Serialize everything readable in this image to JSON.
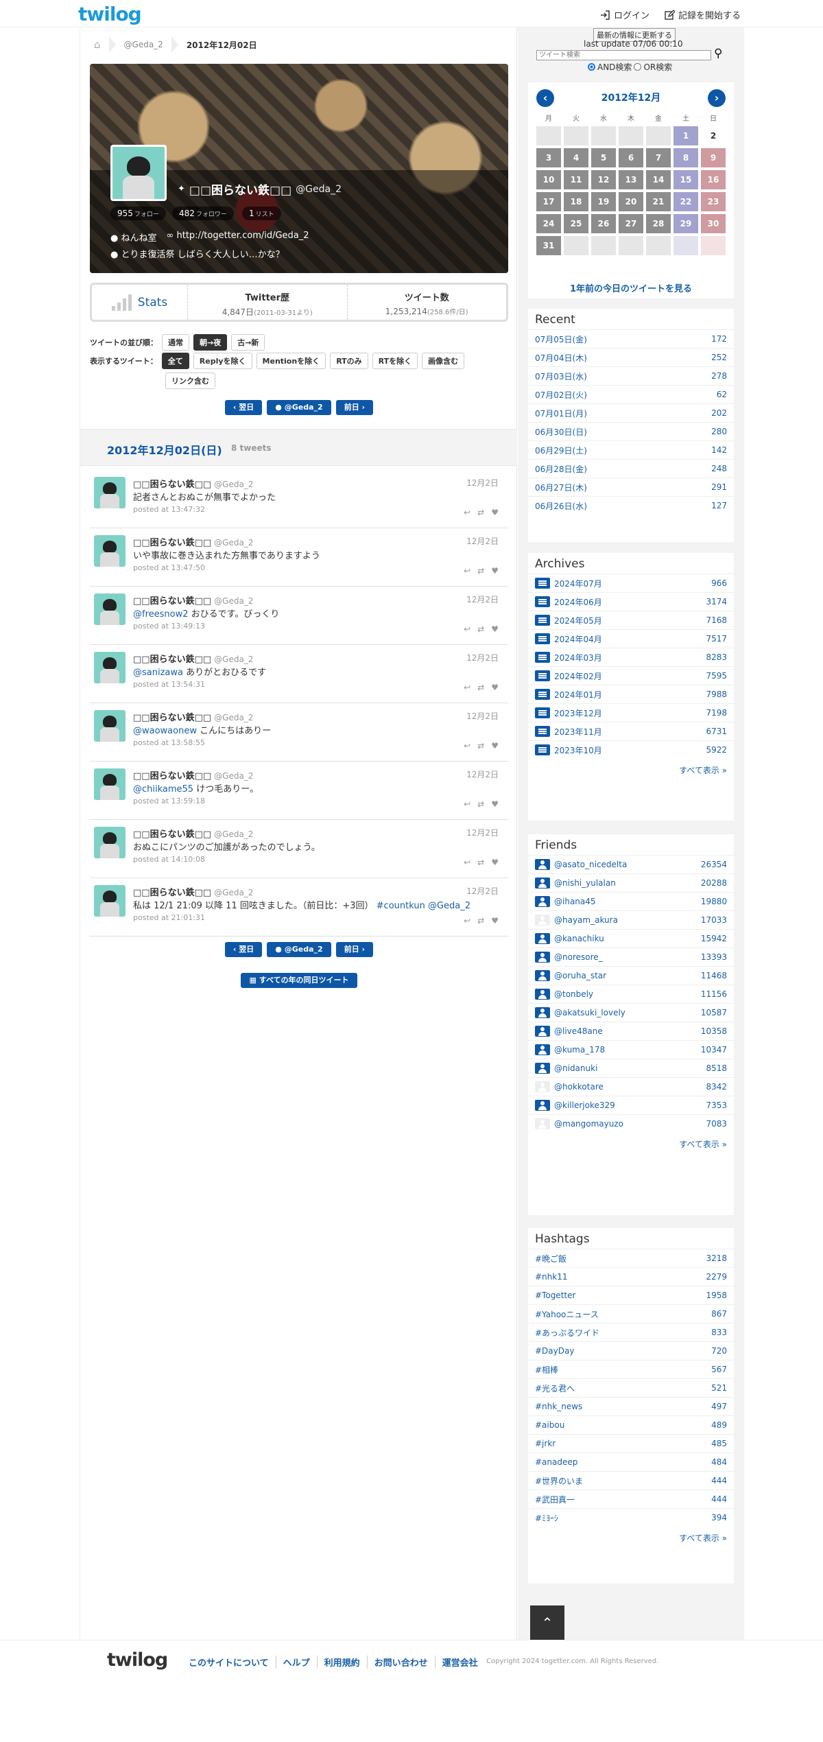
{
  "header": {
    "logo": "twilog",
    "login": "ログイン",
    "start": "記録を開始する"
  },
  "breadcrumb": {
    "user": "@Geda_2",
    "current": "2012年12月02日"
  },
  "profile": {
    "name": "□□困らない鉄□□",
    "screen_name": "@Geda_2",
    "follow_count": "955",
    "follow_label": "フォロー",
    "follower_count": "482",
    "follower_label": "フォロワー",
    "list_count": "1",
    "list_label": "リスト",
    "location": "ねんね室",
    "url": "http://togetter.com/id/Geda_2",
    "description": "とりま復活祭 しばらく大人しい…かな？"
  },
  "stats": {
    "label": "Stats",
    "history_title": "Twitter歴",
    "history_value": "4,847日",
    "history_note": "(2011-03-31より)",
    "tweets_title": "ツイート数",
    "tweets_value": "1,253,214",
    "tweets_note": "(258.6件/日)"
  },
  "filters": {
    "order_label": "ツイートの並び順：",
    "order_options": [
      "通常",
      "朝→夜",
      "古→新"
    ],
    "order_selected": "朝→夜",
    "show_label": "表示するツイート：",
    "show_options": [
      "全て",
      "Replyを除く",
      "Mentionを除く",
      "RTのみ",
      "RTを除く",
      "画像含む",
      "リンク含む"
    ],
    "show_selected": "全て"
  },
  "nav": {
    "next": "翌日",
    "user": "@Geda_2",
    "prev": "前日",
    "same_day": "すべての年の同日ツイート"
  },
  "day": {
    "date": "2012年12月02日(日)",
    "count": "8 tweets"
  },
  "tweets": [
    {
      "name": "□□困らない鉄□□",
      "screen": "@Geda_2",
      "date": "12月2日",
      "text": "記者さんとおぬこが無事でよかった",
      "time": "posted at 13:47:32"
    },
    {
      "name": "□□困らない鉄□□",
      "screen": "@Geda_2",
      "date": "12月2日",
      "text": "いや事故に巻き込まれた方無事でありますよう",
      "time": "posted at 13:47:50"
    },
    {
      "name": "□□困らない鉄□□",
      "screen": "@Geda_2",
      "date": "12月2日",
      "mention": "@freesnow2",
      "text": " おひるです。びっくり",
      "time": "posted at 13:49:13"
    },
    {
      "name": "□□困らない鉄□□",
      "screen": "@Geda_2",
      "date": "12月2日",
      "mention": "@sanizawa",
      "text": " ありがとおひるです",
      "time": "posted at 13:54:31"
    },
    {
      "name": "□□困らない鉄□□",
      "screen": "@Geda_2",
      "date": "12月2日",
      "mention": "@waowaonew",
      "text": " こんにちはありー",
      "time": "posted at 13:58:55"
    },
    {
      "name": "□□困らない鉄□□",
      "screen": "@Geda_2",
      "date": "12月2日",
      "mention": "@chiikame55",
      "text": " けつ毛ありー。",
      "time": "posted at 13:59:18"
    },
    {
      "name": "□□困らない鉄□□",
      "screen": "@Geda_2",
      "date": "12月2日",
      "text": "おぬこにパンツのご加護があったのでしょう。",
      "time": "posted at 14:10:08"
    },
    {
      "name": "□□困らない鉄□□",
      "screen": "@Geda_2",
      "date": "12月2日",
      "text": "私は 12/1 21:09 以降 11 回呟きました。（前日比：+3回）",
      "tag": " #countkun",
      "mention2": " @Geda_2",
      "time": "posted at 21:01:31"
    }
  ],
  "search": {
    "refresh": "最新の情報に更新する",
    "last_update": "last update 07/06 00:10",
    "placeholder": "ツイート検索",
    "and_label": "AND検索",
    "or_label": "OR検索"
  },
  "calendar": {
    "title": "2012年12月",
    "weekdays": [
      "月",
      "火",
      "水",
      "木",
      "金",
      "土",
      "日"
    ],
    "year_ago": "1年前の今日のツイートを見る"
  },
  "recent": {
    "title": "Recent",
    "items": [
      {
        "date": "07月05日(金)",
        "count": "172"
      },
      {
        "date": "07月04日(木)",
        "count": "252"
      },
      {
        "date": "07月03日(水)",
        "count": "278"
      },
      {
        "date": "07月02日(火)",
        "count": "62"
      },
      {
        "date": "07月01日(月)",
        "count": "202"
      },
      {
        "date": "06月30日(日)",
        "count": "280"
      },
      {
        "date": "06月29日(土)",
        "count": "142"
      },
      {
        "date": "06月28日(金)",
        "count": "248"
      },
      {
        "date": "06月27日(木)",
        "count": "291"
      },
      {
        "date": "06月26日(水)",
        "count": "127"
      }
    ]
  },
  "archives": {
    "title": "Archives",
    "more": "すべて表示 »",
    "items": [
      {
        "month": "2024年07月",
        "count": "966"
      },
      {
        "month": "2024年06月",
        "count": "3174"
      },
      {
        "month": "2024年05月",
        "count": "7168"
      },
      {
        "month": "2024年04月",
        "count": "7517"
      },
      {
        "month": "2024年03月",
        "count": "8283"
      },
      {
        "month": "2024年02月",
        "count": "7595"
      },
      {
        "month": "2024年01月",
        "count": "7988"
      },
      {
        "month": "2023年12月",
        "count": "7198"
      },
      {
        "month": "2023年11月",
        "count": "6731"
      },
      {
        "month": "2023年10月",
        "count": "5922"
      }
    ]
  },
  "friends": {
    "title": "Friends",
    "more": "すべて表示 »",
    "items": [
      {
        "name": "@asato_nicedelta",
        "count": "26354"
      },
      {
        "name": "@nishi_yulalan",
        "count": "20288"
      },
      {
        "name": "@ihana45",
        "count": "19880"
      },
      {
        "name": "@hayam_akura",
        "count": "17033"
      },
      {
        "name": "@kanachiku",
        "count": "15942"
      },
      {
        "name": "@noresore_",
        "count": "13393"
      },
      {
        "name": "@oruha_star",
        "count": "11468"
      },
      {
        "name": "@tonbely",
        "count": "11156"
      },
      {
        "name": "@akatsuki_lovely",
        "count": "10587"
      },
      {
        "name": "@live48ane",
        "count": "10358"
      },
      {
        "name": "@kuma_178",
        "count": "10347"
      },
      {
        "name": "@nidanuki",
        "count": "8518"
      },
      {
        "name": "@hokkotare",
        "count": "8342"
      },
      {
        "name": "@killerjoke329",
        "count": "7353"
      },
      {
        "name": "@mangomayuzo",
        "count": "7083"
      }
    ]
  },
  "hashtags": {
    "title": "Hashtags",
    "more": "すべて表示 »",
    "items": [
      {
        "tag": "#晩ご飯",
        "count": "3218"
      },
      {
        "tag": "#nhk11",
        "count": "2279"
      },
      {
        "tag": "#Togetter",
        "count": "1958"
      },
      {
        "tag": "#Yahooニュース",
        "count": "867"
      },
      {
        "tag": "#あっぷるワイド",
        "count": "833"
      },
      {
        "tag": "#DayDay",
        "count": "720"
      },
      {
        "tag": "#相棒",
        "count": "567"
      },
      {
        "tag": "#光る君へ",
        "count": "521"
      },
      {
        "tag": "#nhk_news",
        "count": "497"
      },
      {
        "tag": "#aibou",
        "count": "489"
      },
      {
        "tag": "#jrkr",
        "count": "485"
      },
      {
        "tag": "#anadeep",
        "count": "484"
      },
      {
        "tag": "#世界のいま",
        "count": "444"
      },
      {
        "tag": "#武田真一",
        "count": "444"
      },
      {
        "tag": "#ﾐﾖｰｼ",
        "count": "394"
      }
    ]
  },
  "footer": {
    "logo": "twilog",
    "links": [
      "このサイトについて",
      "ヘルプ",
      "利用規約",
      "お問い合わせ",
      "運営会社"
    ],
    "copyright": "Copyright 2024 togetter.com. All Rights Reserved."
  }
}
